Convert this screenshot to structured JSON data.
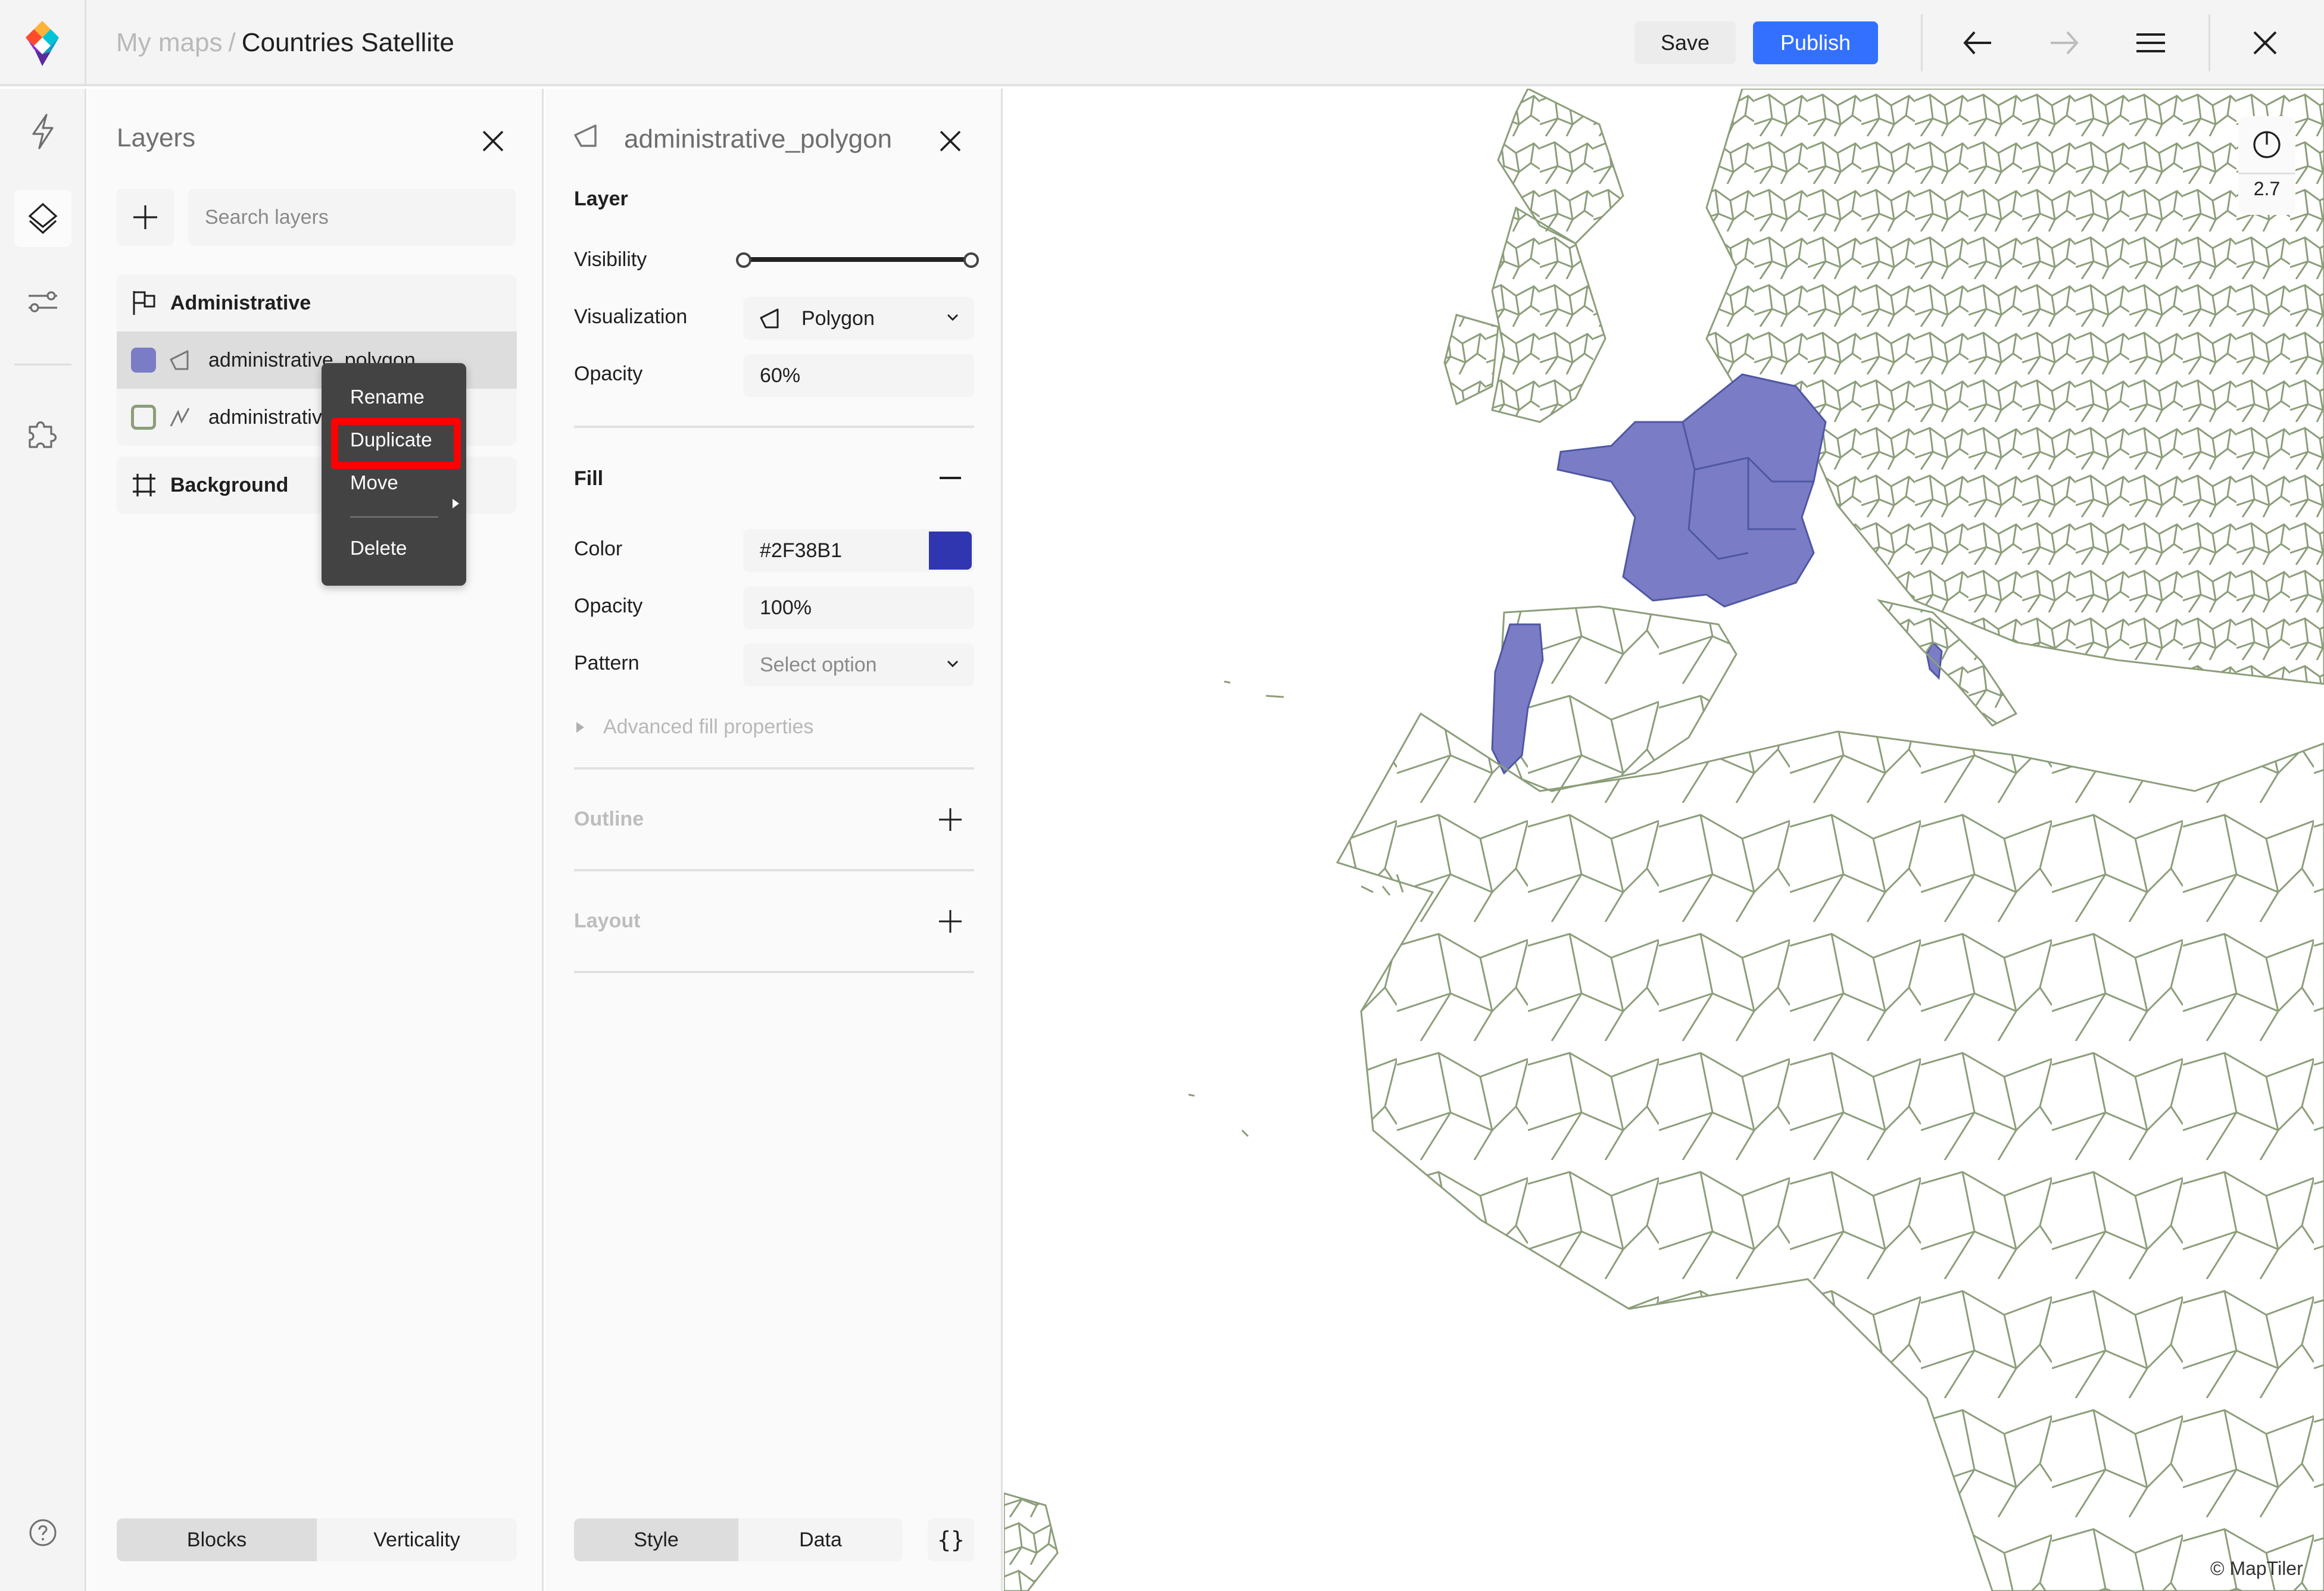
{
  "header": {
    "breadcrumb_parent": "My maps",
    "breadcrumb_separator": "/",
    "map_title": "Countries Satellite",
    "save_label": "Save",
    "publish_label": "Publish",
    "accent_color": "#3370FF"
  },
  "rail": {
    "items": [
      {
        "icon": "lightning-icon",
        "label": "Quick actions",
        "active": false
      },
      {
        "icon": "layers-icon",
        "label": "Layers",
        "active": true
      },
      {
        "icon": "sliders-icon",
        "label": "Settings",
        "active": false
      },
      {
        "icon": "puzzle-icon",
        "label": "Extensions",
        "active": false
      }
    ],
    "help_icon": "help-circle-icon"
  },
  "layers_panel": {
    "title": "Layers",
    "search_placeholder": "Search layers",
    "groups": [
      {
        "name": "Administrative",
        "icon": "flag-icon",
        "layers": [
          {
            "name": "administrative_polygon",
            "type": "polygon",
            "swatch": "#7A7DC5",
            "selected": true
          },
          {
            "name": "administrative_line",
            "type": "line",
            "swatch": "#8C9E7A",
            "selected": false
          }
        ]
      },
      {
        "name": "Background",
        "icon": "frame-icon",
        "layers": []
      }
    ],
    "bottom_tabs": [
      {
        "label": "Blocks",
        "active": true
      },
      {
        "label": "Verticality",
        "active": false
      }
    ]
  },
  "context_menu": {
    "items": [
      {
        "label": "Rename"
      },
      {
        "label": "Duplicate",
        "highlighted": true
      },
      {
        "label": "Move",
        "submenu": true
      },
      {
        "label": "Delete"
      }
    ]
  },
  "style_panel": {
    "layer_name": "administrative_polygon",
    "layer_section": {
      "title": "Layer",
      "visibility_label": "Visibility",
      "visibility_range": [
        0,
        1
      ],
      "visualization_label": "Visualization",
      "visualization_value": "Polygon",
      "opacity_label": "Opacity",
      "opacity_value": "60%"
    },
    "fill_section": {
      "title": "Fill",
      "color_label": "Color",
      "color_value": "#2F38B1",
      "opacity_label": "Opacity",
      "opacity_value": "100%",
      "pattern_label": "Pattern",
      "pattern_placeholder": "Select option",
      "advanced_label": "Advanced fill properties"
    },
    "outline_title": "Outline",
    "layout_title": "Layout",
    "bottom_tabs": [
      {
        "label": "Style",
        "active": true
      },
      {
        "label": "Data",
        "active": false
      }
    ],
    "json_button_label": "{}"
  },
  "map": {
    "zoom_level": "2.7",
    "attribution": "© MapTiler",
    "border_color": "#8C9E7A",
    "highlight_fill": "#7A7DC5",
    "highlighted_regions": [
      "France",
      "Portugal",
      "Corsica"
    ]
  }
}
